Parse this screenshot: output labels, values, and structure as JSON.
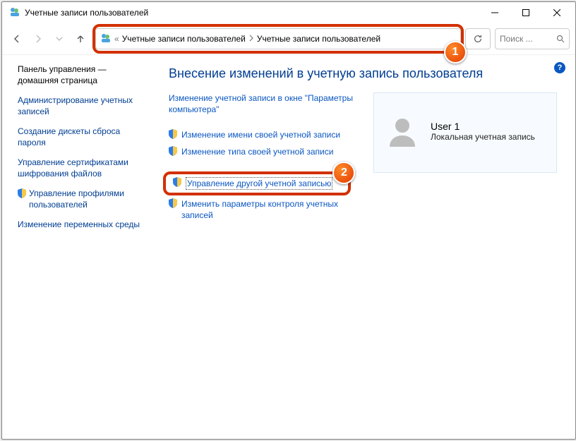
{
  "window": {
    "title": "Учетные записи пользователей"
  },
  "breadcrumb": {
    "seg1": "Учетные записи пользователей",
    "seg2": "Учетные записи пользователей"
  },
  "search": {
    "placeholder": "Поиск ..."
  },
  "sidebar": {
    "home": "Панель управления — домашняя страница",
    "admin": "Администрирование учетных записей",
    "disk": "Создание дискеты сброса пароля",
    "cert": "Управление сертификатами шифрования файлов",
    "profiles": "Управление профилями пользователей",
    "env": "Изменение переменных среды"
  },
  "main": {
    "heading": "Внесение изменений в учетную запись пользователя",
    "link_pcsettings": "Изменение учетной записи в окне \"Параметры компьютера\"",
    "link_rename": "Изменение имени своей учетной записи",
    "link_type": "Изменение типа своей учетной записи",
    "link_manage": "Управление другой учетной записью",
    "link_uac": "Изменить параметры контроля учетных записей"
  },
  "user": {
    "name": "User 1",
    "type": "Локальная учетная запись"
  },
  "badges": {
    "one": "1",
    "two": "2"
  }
}
